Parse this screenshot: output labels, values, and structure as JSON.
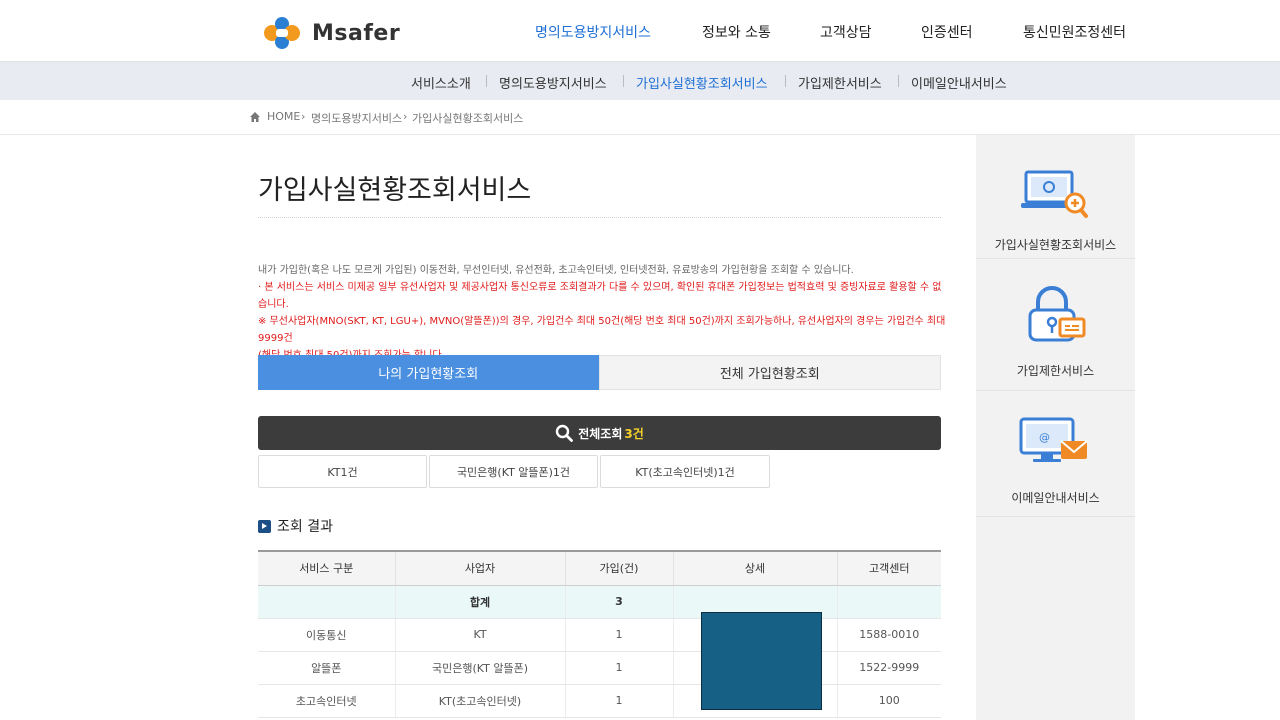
{
  "brand": {
    "name": "Msafer"
  },
  "gnb": [
    {
      "label": "명의도용방지서비스",
      "active": true
    },
    {
      "label": "정보와 소통"
    },
    {
      "label": "고객상담"
    },
    {
      "label": "인증센터"
    },
    {
      "label": "통신민원조정센터"
    }
  ],
  "subnav": [
    {
      "label": "서비스소개"
    },
    {
      "label": "명의도용방지서비스"
    },
    {
      "label": "가입사실현황조회서비스",
      "active": true
    },
    {
      "label": "가입제한서비스"
    },
    {
      "label": "이메일안내서비스"
    }
  ],
  "breadcrumb": [
    "HOME",
    "명의도용방지서비스",
    "가입사실현황조회서비스"
  ],
  "page": {
    "title": "가입사실현황조회서비스",
    "desc_line1": "내가 가입한(혹은 나도 모르게 가입된) 이동전화, 무선인터넷, 유선전화, 초고속인터넷, 인터넷전화, 유료방송의 가입현황을 조회할 수 있습니다.",
    "desc_line2": "· 본 서비스는 서비스 미제공 일부 유선사업자 및 제공사업자 통신오류로 조회결과가 다를 수 있으며, 확인된 휴대폰 가입정보는 법적효력 및 증빙자료로 활용할 수 없습니다.",
    "desc_line3": "※ 무선사업자(MNO(SKT, KT, LGU+), MVNO(알뜰폰))의 경우, 가입건수 최대 50건(해당 번호 최대 50건)까지 조회가능하나, 유선사업자의 경우는 가입건수 최대 9999건",
    "desc_line4": "(해당 번호 최대 50건)까지 조회가능 합니다."
  },
  "tabs": [
    {
      "label": "나의 가입현황조회",
      "active": true
    },
    {
      "label": "전체 가입현황조회"
    }
  ],
  "search": {
    "label": "전체조회",
    "count": "3건"
  },
  "chips": [
    "KT1건",
    "국민은행(KT 알뜰폰)1건",
    "KT(초고속인터넷)1건"
  ],
  "result": {
    "title": "조회 결과",
    "headers": [
      "서비스 구분",
      "사업자",
      "가입(건)",
      "상세",
      "고객센터"
    ],
    "sum": {
      "label": "합계",
      "count": "3"
    },
    "rows": [
      {
        "service": "이동통신",
        "company": "KT",
        "count": "1",
        "detail": "",
        "center": "1588-0010"
      },
      {
        "service": "알뜰폰",
        "company": "국민은행(KT 알뜰폰)",
        "count": "1",
        "detail": "",
        "center": "1522-9999"
      },
      {
        "service": "초고속인터넷",
        "company": "KT(초고속인터넷)",
        "count": "1",
        "detail": "",
        "center": "100"
      }
    ]
  },
  "sidebar": [
    {
      "label": "가입사실현황조회서비스",
      "icon": "laptop-search-icon"
    },
    {
      "label": "가입제한서비스",
      "icon": "lock-icon"
    },
    {
      "label": "이메일안내서비스",
      "icon": "monitor-mail-icon"
    }
  ],
  "colors": {
    "accent": "#1d6fd6",
    "tab_active": "#4a8fe0",
    "search_bar": "#3c3c3c",
    "count_highlight": "#f5d128",
    "notice_red": "#e01a1a",
    "sidebar_icon": "#3a7fd5",
    "sidebar_icon_accent": "#f08a24"
  }
}
